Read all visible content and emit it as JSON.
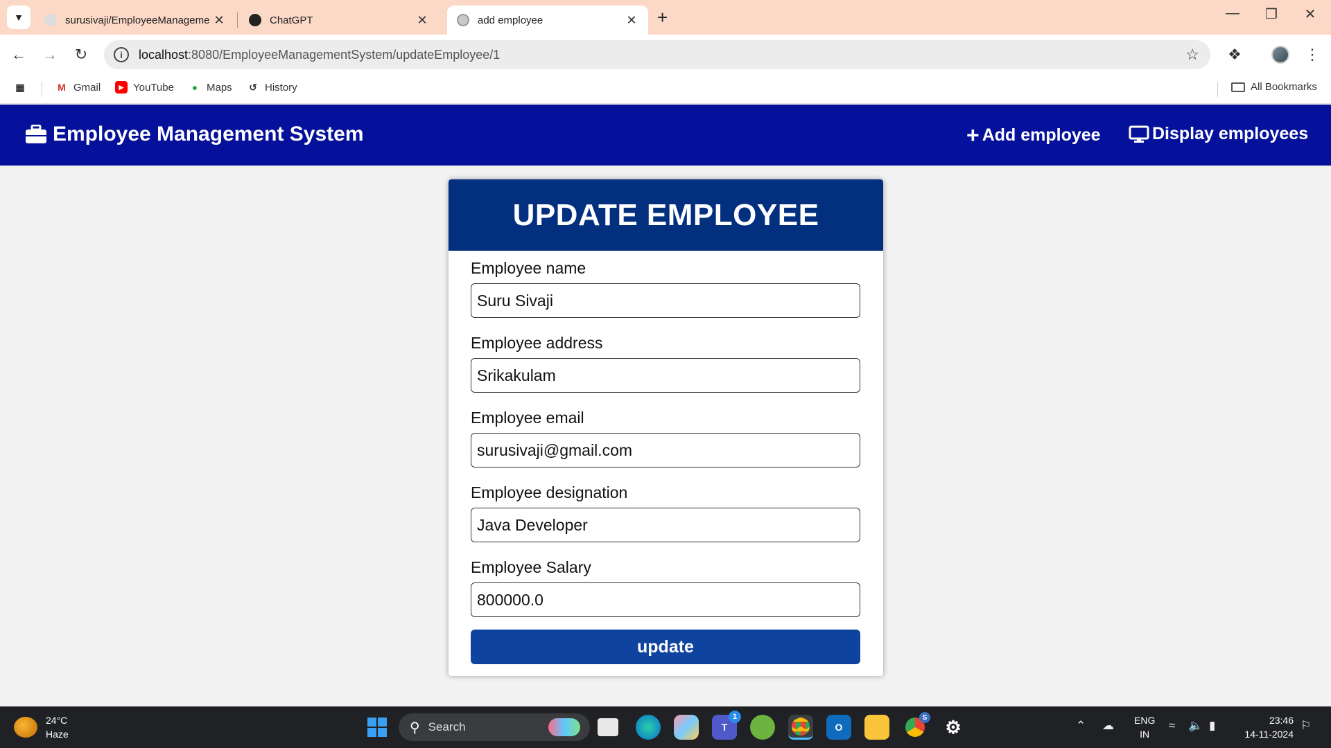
{
  "browser": {
    "tabs": [
      {
        "title": "surusivaji/EmployeeManageme",
        "active": false
      },
      {
        "title": "ChatGPT",
        "active": false
      },
      {
        "title": "add employee",
        "active": true
      }
    ],
    "url_host": "localhost",
    "url_rest": ":8080/EmployeeManagementSystem/updateEmployee/1",
    "bookmarks": [
      "Gmail",
      "YouTube",
      "Maps",
      "History"
    ],
    "all_bookmarks": "All Bookmarks"
  },
  "app": {
    "brand": "Employee Management System",
    "nav": {
      "add": "Add employee",
      "display": "Display employees"
    }
  },
  "form": {
    "heading": "UPDATE EMPLOYEE",
    "fields": [
      {
        "label": "Employee name",
        "value": "Suru Sivaji"
      },
      {
        "label": "Employee address",
        "value": "Srikakulam"
      },
      {
        "label": "Employee email",
        "value": "surusivaji@gmail.com"
      },
      {
        "label": "Employee designation",
        "value": "Java Developer"
      },
      {
        "label": "Employee Salary",
        "value": "800000.0"
      }
    ],
    "submit_label": "update"
  },
  "taskbar": {
    "temperature": "24°C",
    "condition": "Haze",
    "search_label": "Search",
    "lang_top": "ENG",
    "lang_bottom": "IN",
    "time": "23:46",
    "date": "14-11-2024",
    "teams_badge": "1",
    "chrome_badge": "S"
  },
  "colors": {
    "tabbar": "#fbd9c6",
    "appbar": "#06119b",
    "card_header": "#02307f",
    "submit": "#0e43a0"
  }
}
